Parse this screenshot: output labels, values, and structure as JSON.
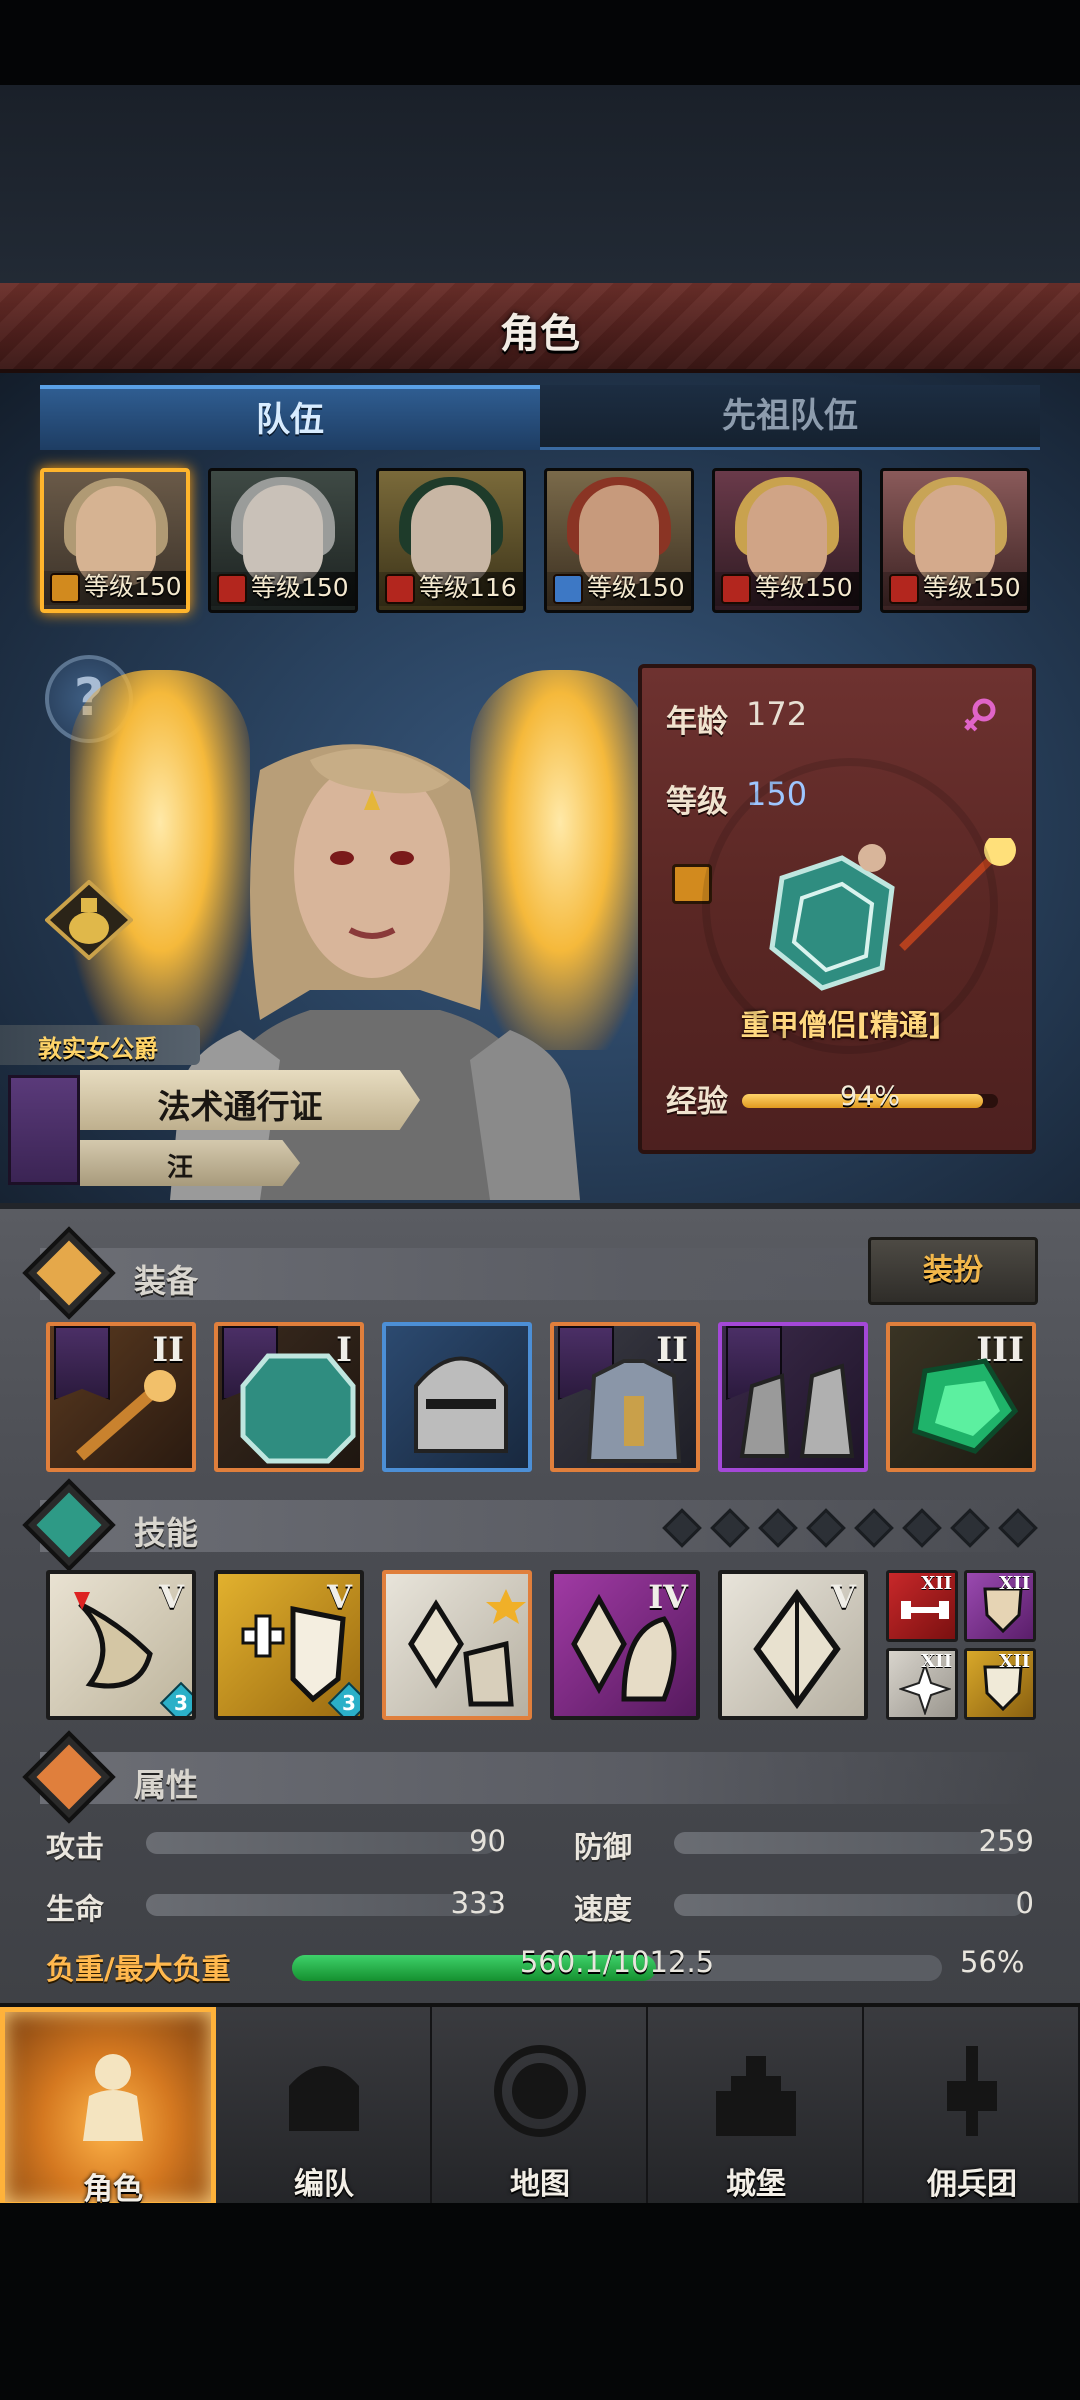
{
  "header": {
    "title": "角色"
  },
  "tabs": [
    {
      "label": "队伍",
      "active": true
    },
    {
      "label": "先祖队伍",
      "active": false
    }
  ],
  "heroes": [
    {
      "level_text": "等级150",
      "class_icon": "shield-class-icon",
      "selected": true
    },
    {
      "level_text": "等级150",
      "class_icon": "horse-class-icon",
      "selected": false
    },
    {
      "level_text": "等级116",
      "class_icon": "horse-class-icon",
      "selected": false
    },
    {
      "level_text": "等级150",
      "class_icon": "sword-class-icon",
      "selected": false
    },
    {
      "level_text": "等级150",
      "class_icon": "horse-class-icon",
      "selected": false
    },
    {
      "level_text": "等级150",
      "class_icon": "horse-class-icon",
      "selected": false
    }
  ],
  "info": {
    "age_label": "年龄",
    "age": "172",
    "level_label": "等级",
    "level": "150",
    "class_name": "重甲僧侣[精通]",
    "xp_label": "经验",
    "xp_text": "94%",
    "xp_fraction": 0.94,
    "gender_icon": "female-icon"
  },
  "titles": {
    "trait": "敦实女公爵",
    "name": "法术通行证",
    "sub": "汪"
  },
  "equipment": {
    "title": "装备",
    "dress_button": "装扮",
    "items": [
      {
        "tier": "II",
        "rarity": "orange",
        "icon": "staff-icon"
      },
      {
        "tier": "I",
        "rarity": "orange",
        "icon": "shield-icon"
      },
      {
        "tier": "",
        "rarity": "blue",
        "icon": "helmet-icon"
      },
      {
        "tier": "II",
        "rarity": "orange",
        "icon": "armor-icon"
      },
      {
        "tier": "",
        "rarity": "purple",
        "icon": "boots-icon"
      },
      {
        "tier": "III",
        "rarity": "orange",
        "icon": "gem-icon"
      }
    ]
  },
  "skills": {
    "title": "技能",
    "items": [
      {
        "tier": "V",
        "badge": "3",
        "icon": "heal-skill-icon"
      },
      {
        "tier": "V",
        "badge": "3",
        "icon": "holy-shield-skill-icon"
      },
      {
        "tier": "",
        "badge": "",
        "icon": "crystal-burst-skill-icon"
      },
      {
        "tier": "IV",
        "badge": "",
        "icon": "crystal-arm-skill-icon"
      },
      {
        "tier": "V",
        "badge": "",
        "icon": "crystal-skill-icon"
      }
    ],
    "passives": [
      {
        "tier": "XII",
        "icon": "strength-passive-icon"
      },
      {
        "tier": "XII",
        "icon": "shield-passive-icon"
      },
      {
        "tier": "XII",
        "icon": "burst-passive-icon"
      },
      {
        "tier": "XII",
        "icon": "defense-passive-icon"
      }
    ]
  },
  "attributes": {
    "title": "属性",
    "attack_label": "攻击",
    "attack": "90",
    "defense_label": "防御",
    "defense": "259",
    "hp_label": "生命",
    "hp": "333",
    "speed_label": "速度",
    "speed": "0",
    "load_label": "负重/最大负重",
    "load_text": "560.1/1012.5",
    "load_pct": "56%",
    "load_fraction": 0.56
  },
  "nav": [
    {
      "label": "角色",
      "active": true,
      "icon": "knight-icon"
    },
    {
      "label": "编队",
      "active": false,
      "icon": "helmet-nav-icon"
    },
    {
      "label": "地图",
      "active": false,
      "icon": "compass-icon"
    },
    {
      "label": "城堡",
      "active": false,
      "icon": "castle-icon"
    },
    {
      "label": "佣兵团",
      "active": false,
      "icon": "fist-banner-icon"
    }
  ],
  "colors": {
    "header": "#5a2724",
    "tab_active": "#2f5d91",
    "selection": "#ffb52c",
    "rarity_orange": "#e07f3c",
    "rarity_blue": "#4c8fd6",
    "rarity_purple": "#a448d8",
    "load_bar": "#3ed16a",
    "xp_bar": "#ffd36a"
  }
}
